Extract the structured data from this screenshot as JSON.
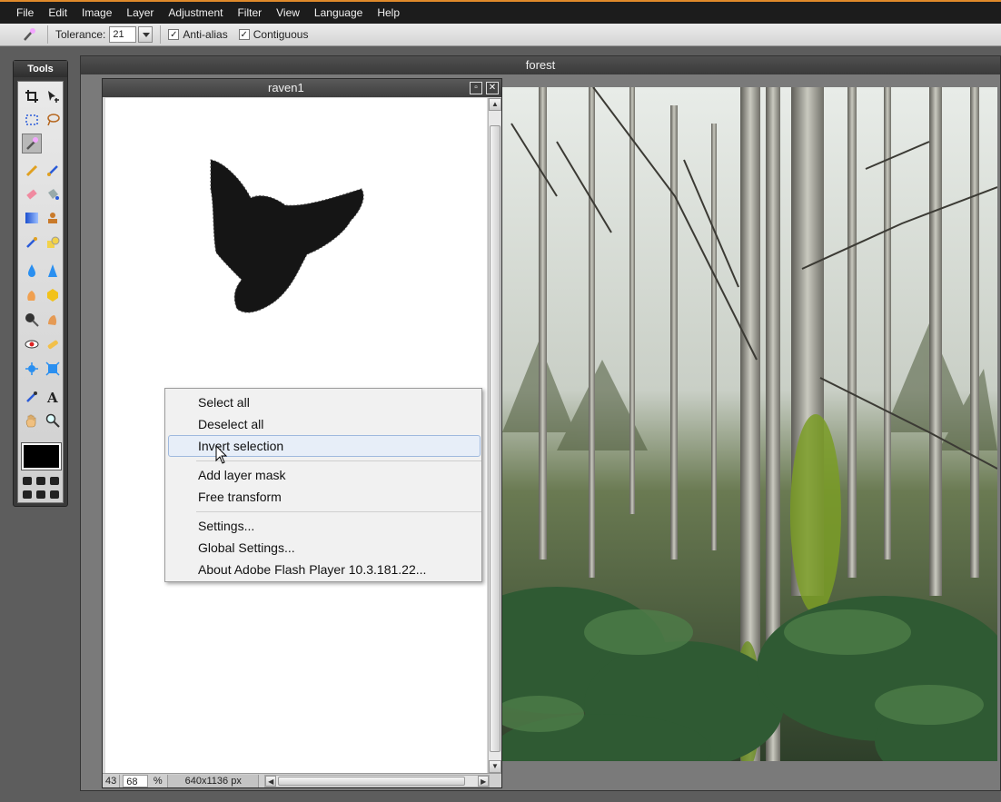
{
  "menubar": {
    "items": [
      "File",
      "Edit",
      "Image",
      "Layer",
      "Adjustment",
      "Filter",
      "View",
      "Language",
      "Help"
    ]
  },
  "options": {
    "tolerance_label": "Tolerance:",
    "tolerance_value": "21",
    "antialias_label": "Anti-alias",
    "antialias_checked": true,
    "contiguous_label": "Contiguous",
    "contiguous_checked": true
  },
  "tools": {
    "title": "Tools",
    "active": "magic-wand",
    "foreground_color": "#000000",
    "icons": [
      "crop-icon",
      "move-icon",
      "marquee-icon",
      "lasso-icon",
      "magic-wand-icon",
      "pencil-icon",
      "brush-icon",
      "eraser-icon",
      "bucket-icon",
      "gradient-icon",
      "stamp-icon",
      "color-replace-icon",
      "shapes-icon",
      "blur-icon",
      "sharpen-icon",
      "smudge-icon",
      "sponge-icon",
      "dodge-icon",
      "burn-icon",
      "red-eye-icon",
      "spot-heal-icon",
      "bloat-icon",
      "pinch-icon",
      "color-picker-icon",
      "type-icon",
      "hand-icon",
      "zoom-icon"
    ]
  },
  "forest_window": {
    "title": "forest"
  },
  "raven_window": {
    "title": "raven1",
    "status": {
      "left": "43",
      "zoom": "68",
      "percent": "%",
      "size": "640x1136 px"
    }
  },
  "context_menu": {
    "items": [
      {
        "label": "Select all"
      },
      {
        "label": "Deselect all"
      },
      {
        "label": "Invert selection",
        "highlighted": true
      },
      {
        "label": "Add layer mask"
      },
      {
        "label": "Free transform"
      },
      {
        "label": "Settings..."
      },
      {
        "label": "Global Settings..."
      },
      {
        "label": "About Adobe Flash Player 10.3.181.22..."
      }
    ]
  },
  "colors": {
    "menubar_bg": "#1c1c1c",
    "accent_top": "#e08a2a",
    "highlight": "#e7eef8"
  }
}
